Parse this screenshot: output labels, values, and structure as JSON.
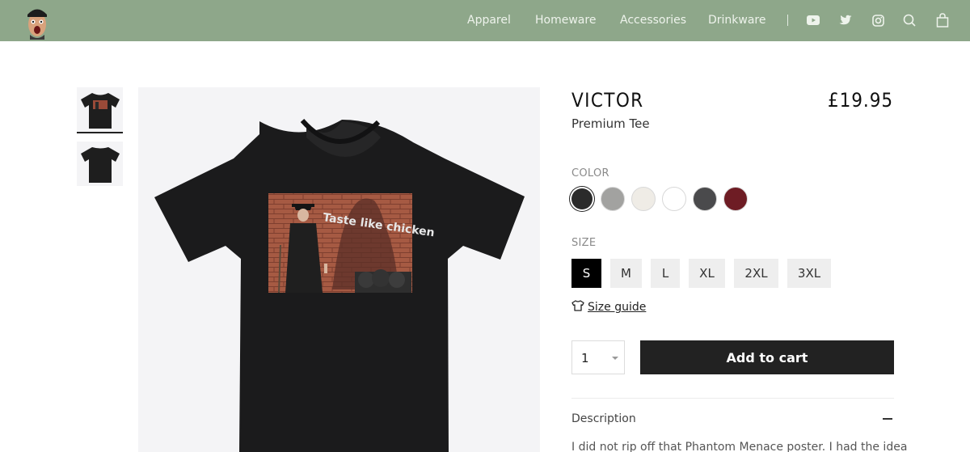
{
  "header": {
    "nav": [
      "Apparel",
      "Homeware",
      "Accessories",
      "Drinkware"
    ],
    "icons": [
      "youtube-icon",
      "twitter-icon",
      "instagram-icon",
      "search-icon",
      "cart-icon"
    ],
    "background": "#8ea78a"
  },
  "product": {
    "title": "VICTOR",
    "subtitle": "Premium Tee",
    "price": "£19.95",
    "print_graffiti": "Taste like chicken"
  },
  "color": {
    "label": "COLOR",
    "options": [
      "#2b2b2b",
      "#a2a2a0",
      "#efece6",
      "#ffffff",
      "#4a4a4c",
      "#6e1c24"
    ],
    "selected_index": 0
  },
  "size": {
    "label": "SIZE",
    "options": [
      "S",
      "M",
      "L",
      "XL",
      "2XL",
      "3XL"
    ],
    "selected": "S",
    "guide_label": "Size guide"
  },
  "cart": {
    "quantity": "1",
    "add_label": "Add to cart"
  },
  "description": {
    "label": "Description",
    "text": "I did not rip off that Phantom Menace poster. I had the idea first. I"
  }
}
